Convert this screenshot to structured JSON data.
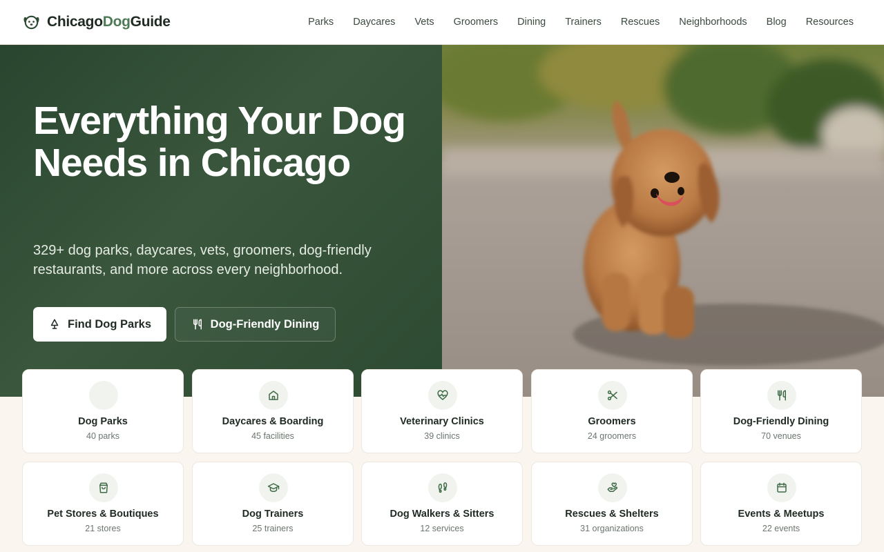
{
  "header": {
    "logo": {
      "part1": "Chicago",
      "part2": "Dog",
      "part3": "Guide",
      "icon": "dog-face-icon"
    },
    "nav": [
      "Parks",
      "Daycares",
      "Vets",
      "Groomers",
      "Dining",
      "Trainers",
      "Rescues",
      "Neighborhoods",
      "Blog",
      "Resources"
    ]
  },
  "hero": {
    "title": "Everything Your Dog Needs in Chicago",
    "subtitle": "329+ dog parks, daycares, vets, groomers, dog-friendly restaurants, and more across every neighborhood.",
    "primary_button": {
      "label": "Find Dog Parks",
      "icon": "tree-icon"
    },
    "secondary_button": {
      "label": "Dog-Friendly Dining",
      "icon": "utensils-icon"
    },
    "image": "puppy-photo"
  },
  "categories": [
    {
      "title": "Dog Parks",
      "count": "40 parks",
      "icon": "tree-icon"
    },
    {
      "title": "Daycares & Boarding",
      "count": "45 facilities",
      "icon": "house-icon"
    },
    {
      "title": "Veterinary Clinics",
      "count": "39 clinics",
      "icon": "heart-pulse-icon"
    },
    {
      "title": "Groomers",
      "count": "24 groomers",
      "icon": "scissors-icon"
    },
    {
      "title": "Dog-Friendly Dining",
      "count": "70 venues",
      "icon": "utensils-icon"
    },
    {
      "title": "Pet Stores & Boutiques",
      "count": "21 stores",
      "icon": "shopping-bag-icon"
    },
    {
      "title": "Dog Trainers",
      "count": "25 trainers",
      "icon": "graduation-cap-icon"
    },
    {
      "title": "Dog Walkers & Sitters",
      "count": "12 services",
      "icon": "footprints-icon"
    },
    {
      "title": "Rescues & Shelters",
      "count": "31 organizations",
      "icon": "hand-heart-icon"
    },
    {
      "title": "Events & Meetups",
      "count": "22 events",
      "icon": "calendar-icon"
    }
  ],
  "colors": {
    "brand_dark": "#2d4a32",
    "accent": "#4e7a55",
    "background": "#faf6ef"
  }
}
